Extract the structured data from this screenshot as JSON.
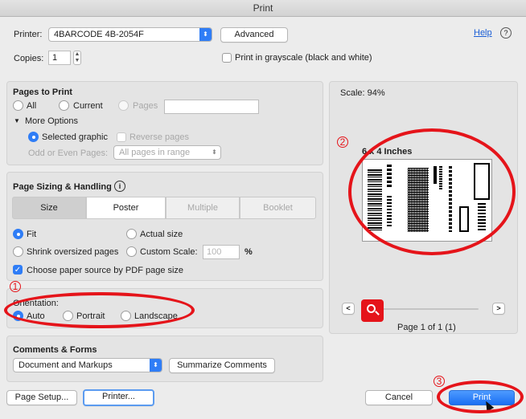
{
  "window": {
    "title": "Print"
  },
  "top": {
    "printer_label": "Printer:",
    "printer_value": "4BARCODE 4B-2054F",
    "advanced_label": "Advanced",
    "help_label": "Help",
    "help_icon": "?",
    "copies_label": "Copies:",
    "copies_value": "1",
    "grayscale_label": "Print in grayscale (black and white)"
  },
  "pages": {
    "heading": "Pages to Print",
    "all": "All",
    "current": "Current",
    "pages": "Pages",
    "more_options": "More Options",
    "selected_graphic": "Selected graphic",
    "reverse_pages": "Reverse pages",
    "odd_even_label": "Odd or Even Pages:",
    "odd_even_value": "All pages in range"
  },
  "sizing": {
    "heading": "Page Sizing & Handling",
    "tabs": [
      "Size",
      "Poster",
      "Multiple",
      "Booklet"
    ],
    "fit": "Fit",
    "actual_size": "Actual size",
    "shrink": "Shrink oversized pages",
    "custom_scale": "Custom Scale:",
    "custom_scale_value": "100",
    "percent": "%",
    "paper_source": "Choose paper source by PDF page size"
  },
  "orientation": {
    "heading": "Orientation:",
    "auto": "Auto",
    "portrait": "Portrait",
    "landscape": "Landscape"
  },
  "comments": {
    "heading": "Comments & Forms",
    "value": "Document and Markups",
    "summarize": "Summarize Comments"
  },
  "preview": {
    "scale": "Scale: 94%",
    "size": "6 x 4 Inches",
    "page_info": "Page 1 of 1 (1)",
    "prev": "<",
    "next": ">"
  },
  "bottom": {
    "page_setup": "Page Setup...",
    "printer": "Printer...",
    "cancel": "Cancel",
    "print": "Print"
  },
  "annotations": {
    "one": "1",
    "two": "2",
    "three": "3"
  },
  "colors": {
    "accent": "#2f7df6",
    "annotation": "#e5141a",
    "zoom_badge": "#e5141a"
  }
}
